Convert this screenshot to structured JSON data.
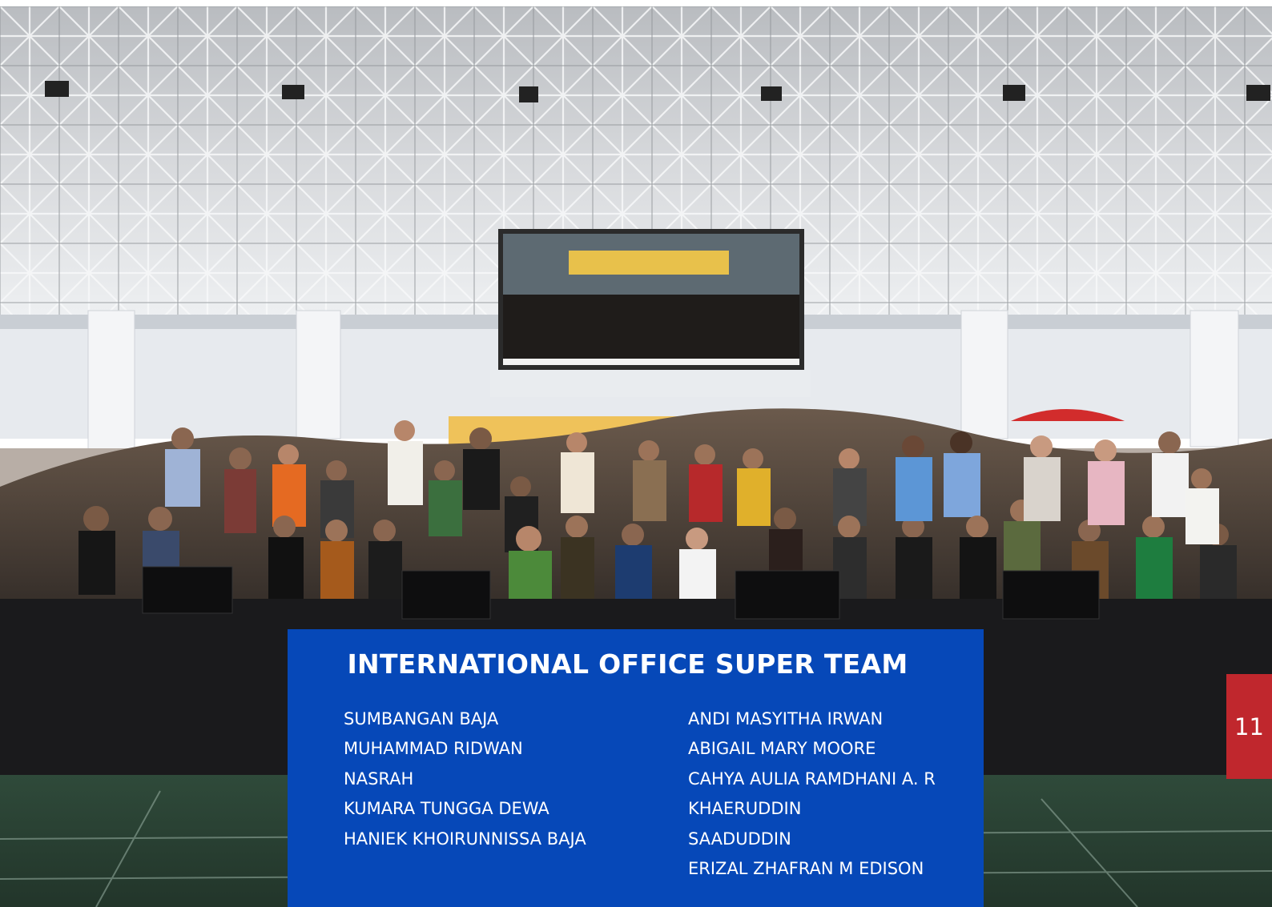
{
  "panel": {
    "title": "INTERNATIONAL OFFICE SUPER TEAM",
    "left_column": [
      "SUMBANGAN BAJA",
      "MUHAMMAD RIDWAN",
      "NASRAH",
      "KUMARA TUNGGA DEWA",
      "HANIEK KHOIRUNNISSA BAJA"
    ],
    "right_column": [
      "ANDI MASYITHA IRWAN",
      "ABIGAIL MARY MOORE",
      "CAHYA AULIA RAMDHANI A. R",
      "KHAERUDDIN",
      "SAADUDDIN",
      "ERIZAL ZHAFRAN M EDISON"
    ]
  },
  "page_number": "11",
  "colors": {
    "panel_background": "#0648b8",
    "page_number_background": "#c0272d",
    "text": "#ffffff"
  }
}
